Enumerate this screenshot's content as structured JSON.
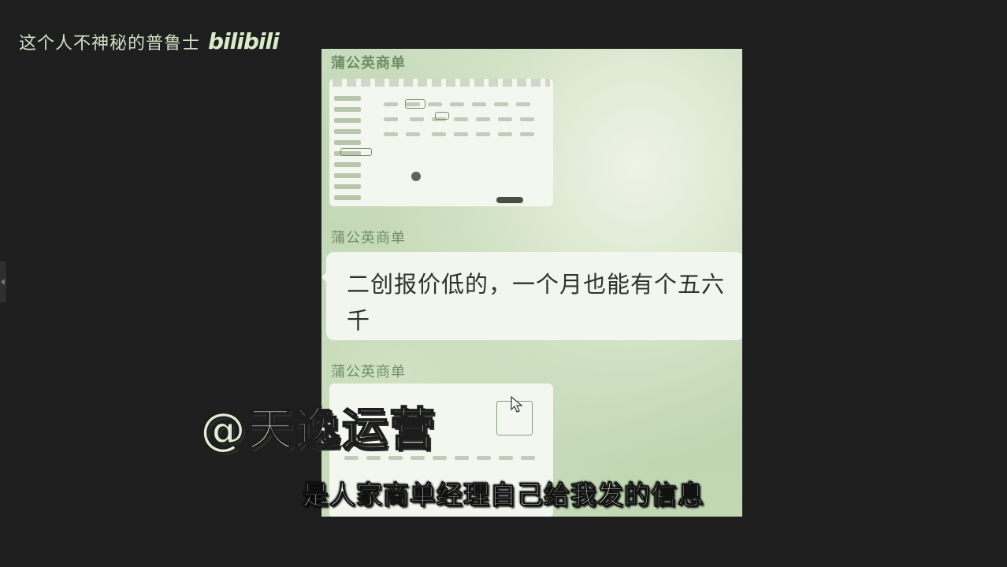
{
  "header": {
    "channel_name": "这个人不神秘的普鲁士",
    "logo_text": "bilibili"
  },
  "chat": {
    "messages": [
      {
        "sender": "蒲公英商单",
        "type": "image"
      },
      {
        "sender": "蒲公英商单",
        "type": "text",
        "text": "二创报价低的，一个月也能有个五六千"
      },
      {
        "sender": "蒲公英商单",
        "type": "image"
      }
    ]
  },
  "overlay": {
    "watermark": "@天逸运营",
    "subtitle": "是人家商单经理自己给我发的信息"
  },
  "colors": {
    "background": "#1e1e1e",
    "chat_green": "#c2d8b5",
    "subtitle_text": "#ffffff"
  }
}
